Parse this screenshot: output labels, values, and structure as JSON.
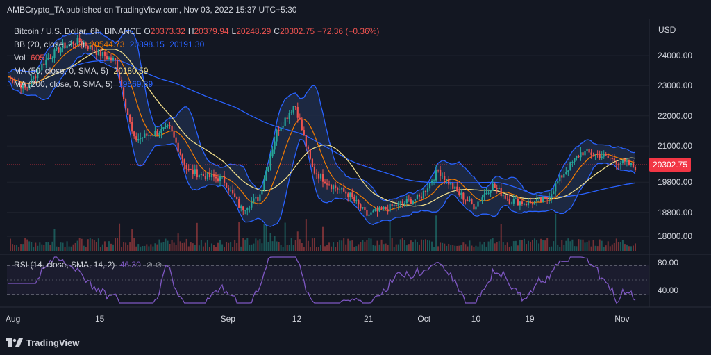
{
  "header": {
    "published_line": "AMBCrypto_TA published on TradingView.com, Nov 03, 2022 15:37 UTC+5:30"
  },
  "legend": {
    "symbol": "Bitcoin / U.S. Dollar, 6h, BINANCE",
    "open_label": "O",
    "open": "20373.32",
    "high_label": "H",
    "high": "20379.94",
    "low_label": "L",
    "low": "20248.29",
    "close_label": "C",
    "close": "20302.75",
    "change": "−72.36 (−0.36%)",
    "bb_label": "BB (20, close, 2, 0)",
    "bb_basis": "20544.73",
    "bb_upper": "20898.15",
    "bb_lower": "20191.30",
    "vol_label": "Vol",
    "vol": "605",
    "ma50_label": "MA (50, close, 0, SMA, 5)",
    "ma50": "20180.59",
    "ma200_label": "MA (200, close, 0, SMA, 5)",
    "ma200": "19569.89",
    "rsi_label": "RSI (14, close, SMA, 14, 2)",
    "rsi": "46.30",
    "rsi_dots": "⊘ ⊘"
  },
  "axis": {
    "currency": "USD",
    "price_ticks": [
      "24000.00",
      "23000.00",
      "22000.00",
      "21000.00",
      "19800.00",
      "18800.00",
      "18000.00"
    ],
    "rsi_ticks": [
      "80.00",
      "40.00"
    ],
    "current_price": "20302.75",
    "x_ticks": [
      "Aug",
      "15",
      "Sep",
      "12",
      "21",
      "Oct",
      "10",
      "19",
      "Nov"
    ]
  },
  "footer": {
    "brand": "TradingView"
  },
  "colors": {
    "background": "#131722",
    "up": "#26a69a",
    "down": "#ef5350",
    "bb_line": "#2962ff",
    "bb_fill": "#1e2a44",
    "ma50": "#f0dd8a",
    "ma200": "#2962ff",
    "ema": "#f57c00",
    "rsi": "#7e57c2",
    "price_tag": "#f23645"
  },
  "chart_data": {
    "type": "candlestick",
    "symbol": "Bitcoin / U.S. Dollar",
    "interval": "6h",
    "exchange": "BINANCE",
    "x_range": [
      "Aug",
      "Nov"
    ],
    "y_price_range": [
      17500,
      25200
    ],
    "rsi_range": [
      20,
      90
    ],
    "close_series": [
      {
        "date": "Aug 01",
        "close": 23300
      },
      {
        "date": "Aug 04",
        "close": 22900
      },
      {
        "date": "Aug 08",
        "close": 23800
      },
      {
        "date": "Aug 11",
        "close": 24300
      },
      {
        "date": "Aug 14",
        "close": 24500
      },
      {
        "date": "Aug 15",
        "close": 24100
      },
      {
        "date": "Aug 17",
        "close": 23800
      },
      {
        "date": "Aug 19",
        "close": 21200
      },
      {
        "date": "Aug 22",
        "close": 21400
      },
      {
        "date": "Aug 25",
        "close": 21600
      },
      {
        "date": "Aug 28",
        "close": 20200
      },
      {
        "date": "Aug 31",
        "close": 20000
      },
      {
        "date": "Sep 03",
        "close": 19900
      },
      {
        "date": "Sep 06",
        "close": 18900
      },
      {
        "date": "Sep 08",
        "close": 19300
      },
      {
        "date": "Sep 10",
        "close": 21500
      },
      {
        "date": "Sep 12",
        "close": 22400
      },
      {
        "date": "Sep 13",
        "close": 20200
      },
      {
        "date": "Sep 16",
        "close": 19700
      },
      {
        "date": "Sep 19",
        "close": 19400
      },
      {
        "date": "Sep 21",
        "close": 18700
      },
      {
        "date": "Sep 24",
        "close": 18900
      },
      {
        "date": "Sep 28",
        "close": 19100
      },
      {
        "date": "Oct 01",
        "close": 19300
      },
      {
        "date": "Oct 05",
        "close": 20200
      },
      {
        "date": "Oct 08",
        "close": 19500
      },
      {
        "date": "Oct 11",
        "close": 19000
      },
      {
        "date": "Oct 13",
        "close": 19700
      },
      {
        "date": "Oct 16",
        "close": 19200
      },
      {
        "date": "Oct 19",
        "close": 19100
      },
      {
        "date": "Oct 22",
        "close": 19200
      },
      {
        "date": "Oct 25",
        "close": 20100
      },
      {
        "date": "Oct 26",
        "close": 20800
      },
      {
        "date": "Oct 29",
        "close": 20700
      },
      {
        "date": "Nov 01",
        "close": 20500
      },
      {
        "date": "Nov 03",
        "close": 20302.75
      }
    ]
  }
}
